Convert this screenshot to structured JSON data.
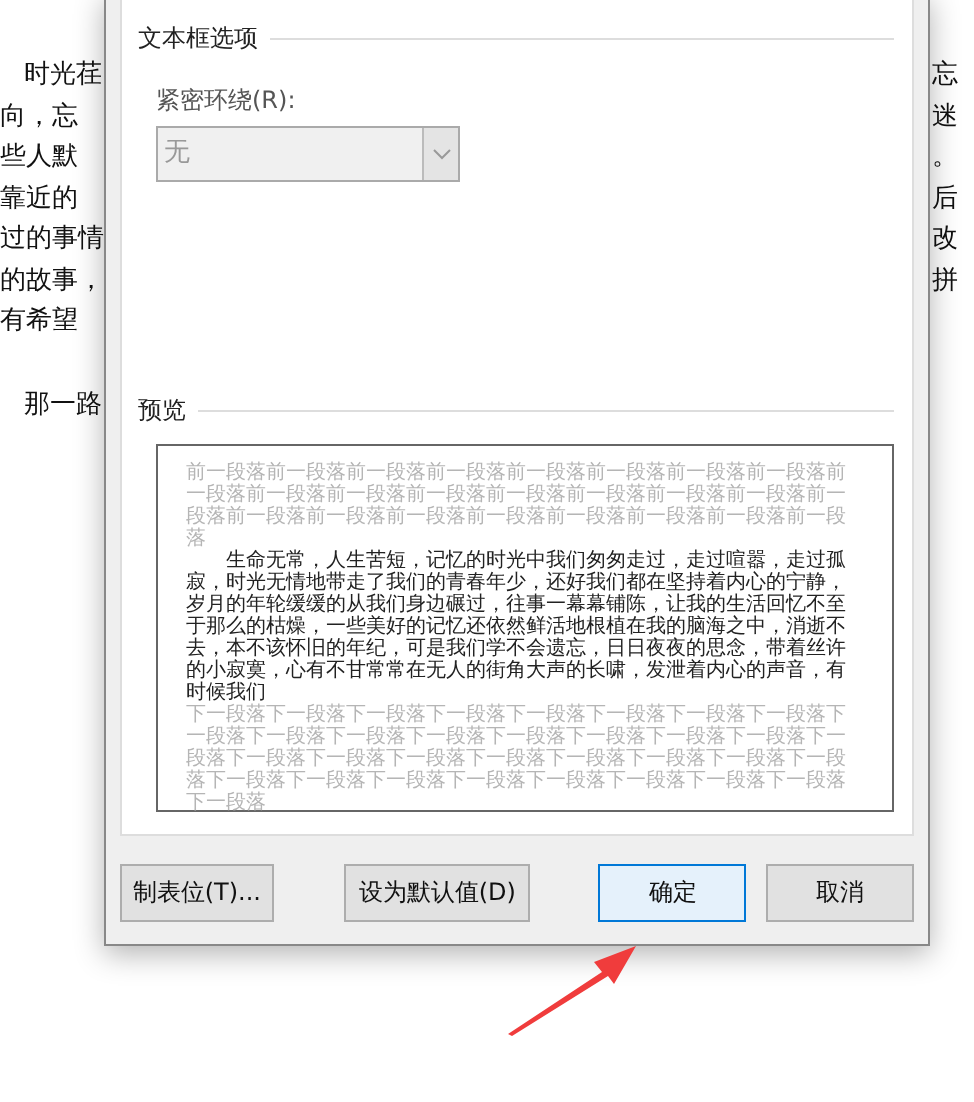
{
  "document": {
    "left_lines": [
      "时光荏",
      "向，忘",
      "些人默",
      "靠近的",
      "过的事情",
      "的故事，",
      "有希望"
    ],
    "left_last": "那一路",
    "right_lines": [
      "忘",
      "迷",
      "。",
      "后",
      "改",
      "拼"
    ]
  },
  "dialog": {
    "section_title": "文本框选项",
    "wrap_label": "紧密环绕(R):",
    "wrap_select": {
      "value": "无",
      "disabled": true
    },
    "preview_title": "预览",
    "preview": {
      "before": "前一段落前一段落前一段落前一段落前一段落前一段落前一段落前一段落前一段落前一段落前一段落前一段落前一段落前一段落前一段落前一段落前一段落前一段落前一段落前一段落前一段落前一段落前一段落前一段落前一段落",
      "body": "生命无常，人生苦短，记忆的时光中我们匆匆走过，走过喧嚣，走过孤寂，时光无情地带走了我们的青春年少，还好我们都在坚持着内心的宁静，岁月的年轮缓缓的从我们身边碾过，往事一幕幕铺陈，让我的生活回忆不至于那么的枯燥，一些美好的记忆还依然鲜活地根植在我的脑海之中，消逝不去，本不该怀旧的年纪，可是我们学不会遗忘，日日夜夜的思念，带着丝许的小寂寞，心有不甘常常在无人的街角大声的长啸，发泄着内心的声音，有时候我们",
      "after": "下一段落下一段落下一段落下一段落下一段落下一段落下一段落下一段落下一段落下一段落下一段落下一段落下一段落下一段落下一段落下一段落下一段落下一段落下一段落下一段落下一段落下一段落下一段落下一段落下一段落下一段落下一段落下一段落下一段落下一段落下一段落下一段落下一段落下一段落"
    },
    "buttons": [
      {
        "label": "制表位(T)...",
        "selected": false
      },
      {
        "label": "设为默认值(D)",
        "selected": false
      },
      {
        "label": "确定",
        "selected": true
      },
      {
        "label": "取消",
        "selected": false
      }
    ]
  }
}
